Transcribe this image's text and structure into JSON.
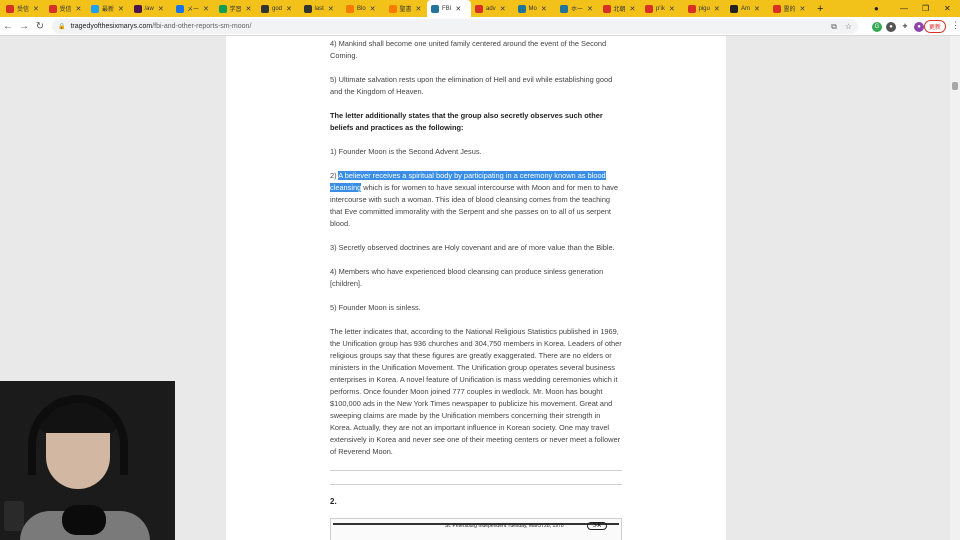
{
  "browser": {
    "tabs": [
      {
        "label": "受信",
        "color": "#d93025",
        "active": false
      },
      {
        "label": "受信",
        "color": "#d93025",
        "active": false
      },
      {
        "label": "最新",
        "color": "#1da1f2",
        "active": false
      },
      {
        "label": "/aw",
        "color": "#4a154b",
        "active": false
      },
      {
        "label": "メー",
        "color": "#1a73e8",
        "active": false
      },
      {
        "label": "学習",
        "color": "#0f9d58",
        "active": false
      },
      {
        "label": "god",
        "color": "#333333",
        "active": false
      },
      {
        "label": "last",
        "color": "#333333",
        "active": false
      },
      {
        "label": "Blo",
        "color": "#f57c00",
        "active": false
      },
      {
        "label": "聖書",
        "color": "#f57c00",
        "active": false
      },
      {
        "label": "FBI",
        "color": "#21759b",
        "active": true
      },
      {
        "label": "adv",
        "color": "#d93025",
        "active": false
      },
      {
        "label": "Mo",
        "color": "#21759b",
        "active": false
      },
      {
        "label": "ホー",
        "color": "#21759b",
        "active": false
      },
      {
        "label": "北朝",
        "color": "#d93025",
        "active": false
      },
      {
        "label": "p'ik",
        "color": "#d93025",
        "active": false
      },
      {
        "label": "pigu",
        "color": "#d93025",
        "active": false
      },
      {
        "label": "Am",
        "color": "#222222",
        "active": false
      },
      {
        "label": "霊的",
        "color": "#d93025",
        "active": false
      }
    ],
    "new_tab": "+",
    "url_host": "tragedyofthesixmarys.com",
    "url_path": "/fbi-and-other-reports-sm-moon/",
    "update_label": "更新"
  },
  "article": {
    "p_mankind": "4) Mankind shall become one united family centered around the event of the Second Coming.",
    "p_salvation": "5) Ultimate salvation rests upon the elimination of Hell and evil while establishing good and the Kingdom of Heaven.",
    "p_letter_bold": "The letter additionally states that the group also secretly observes such other beliefs and practices as the following:",
    "p_founder": "1) Founder Moon is the Second Advent Jesus.",
    "p_believer_prefix": "2) ",
    "p_believer_selected": "A believer receives a spiritual body by participating in a ceremony known as blood cleansing",
    "p_believer_rest": " which is for women to have sexual intercourse with Moon and for men to have intercourse with such a woman. This idea of blood cleansing comes from the teaching that Eve committed immorality with the Serpent and she passes on to all of us serpent blood.",
    "p_covenant": "3) Secretly observed doctrines are Holy covenant and are of more value than the Bible.",
    "p_members": "4) Members who have experienced blood cleansing can produce sinless generation [children].",
    "p_sinless": "5) Founder Moon is sinless.",
    "p_statistics": "The letter indicates that, according to the National Religious Statistics published in 1969, the Unification group has 936 churches and 304,750 members in Korea. Leaders of other religious groups say that these figures are greatly exaggerated. There are no elders or ministers in the Unification Movement. The Unification group operates several business enterprises in Korea. A novel feature of Unification is mass wedding ceremonies which it performs. Once founder Moon joined 777 couples in wedlock. Mr. Moon has bought $100,000 ads in the New York Times newspaper to publicize his movement. Great and sweeping claims are made by the Unification members concerning their strength in Korea. Actually, they are not an important influence in Korean society. One may travel extensively in Korea and never see one of their meeting centers or never meet a follower of Reverend Moon.",
    "section_number": "2.",
    "clipping_header": "St. Petersburg Independent   Tuesday, March 28, 1978",
    "clipping_badge": "3-A"
  }
}
